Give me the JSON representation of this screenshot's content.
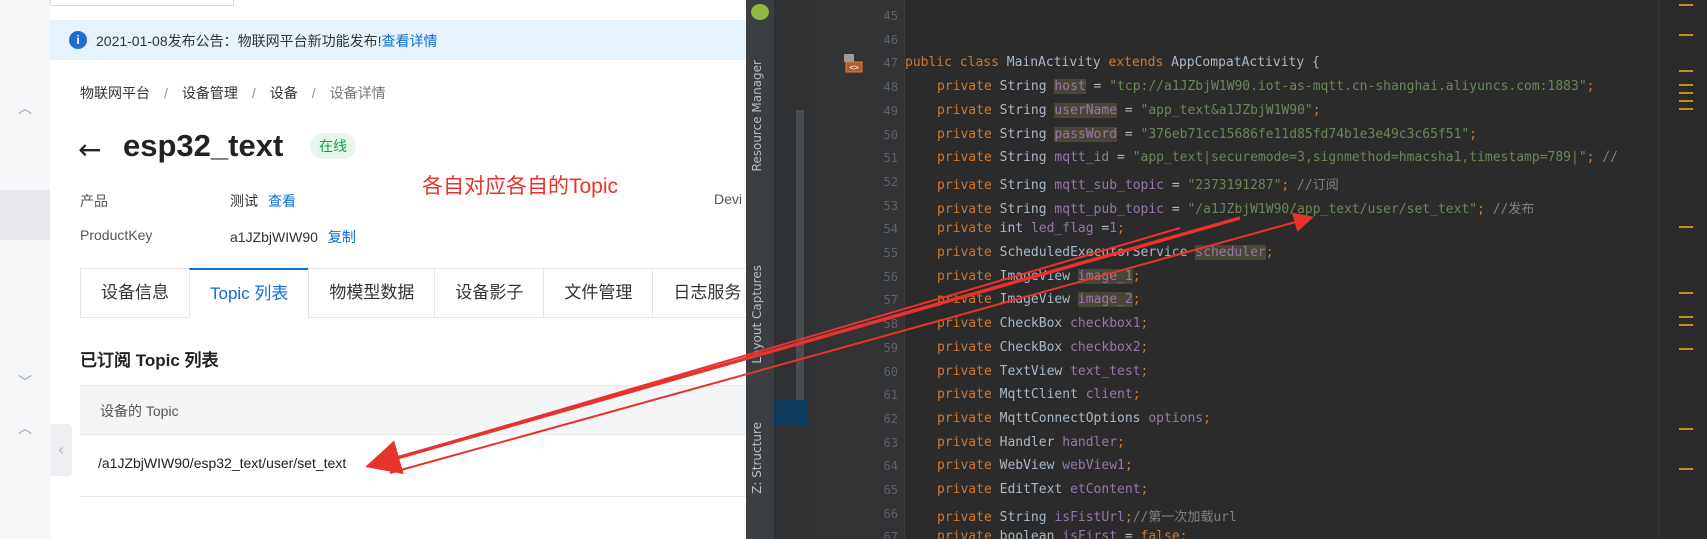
{
  "notice": {
    "text": "2021-01-08发布公告：物联网平台新功能发布!",
    "link": "查看详情"
  },
  "breadcrumb": [
    "物联网平台",
    "设备管理",
    "设备",
    "设备详情"
  ],
  "device": {
    "name": "esp32_text",
    "status": "在线",
    "product_label": "产品",
    "product_value": "测试",
    "product_link": "查看",
    "productkey_label": "ProductKey",
    "productkey_value": "a1JZbjWIW90",
    "productkey_link": "复制",
    "device_label_cut": "Devi"
  },
  "annotation": "各自对应各自的Topic",
  "tabs": [
    "设备信息",
    "Topic 列表",
    "物模型数据",
    "设备影子",
    "文件管理",
    "日志服务"
  ],
  "active_tab": 1,
  "subscribed": {
    "title": "已订阅 Topic 列表",
    "column": "设备的 Topic",
    "rows": [
      "/a1JZbjWIW90/esp32_text/user/set_text"
    ]
  },
  "ide": {
    "tool_tabs": [
      "Resource Manager",
      "Layout Captures",
      "Z: Structure"
    ],
    "line_numbers": [
      45,
      46,
      47,
      48,
      49,
      50,
      51,
      52,
      53,
      54,
      55,
      56,
      57,
      58,
      59,
      60,
      61,
      62,
      63,
      64,
      65,
      66,
      67
    ],
    "code": {
      "l47": {
        "a": "public class ",
        "b": "MainActivity ",
        "c": "extends ",
        "d": "AppCompatActivity {"
      },
      "l48": {
        "kw": "private ",
        "type": "String ",
        "name": "host",
        "rest": " = ",
        "str": "\"tcp://a1JZbjW1W90.iot-as-mqtt.cn-shanghai.aliyuncs.com:1883\"",
        "end": ";"
      },
      "l49": {
        "kw": "private ",
        "type": "String ",
        "name": "userName",
        "rest": " = ",
        "str": "\"app_text&a1JZbjW1W90\"",
        "end": ";"
      },
      "l50": {
        "kw": "private ",
        "type": "String ",
        "name": "passWord",
        "rest": " = ",
        "str": "\"376eb71cc15686fe11d85fd74b1e3e49c3c65f51\"",
        "end": ";"
      },
      "l51": {
        "kw": "private ",
        "type": "String ",
        "name": "mqtt_id",
        "rest": " = ",
        "str": "\"app_text|securemode=3,signmethod=hmacsha1,timestamp=789|\"",
        "end": "; //"
      },
      "l52": {
        "kw": "private ",
        "type": "String ",
        "name": "mqtt_sub_topic",
        "rest": " = ",
        "str": "\"2373191287\"",
        "end": "; //订阅"
      },
      "l53": {
        "kw": "private ",
        "type": "String ",
        "name": "mqtt_pub_topic",
        "rest": " = ",
        "str": "\"/a1JZbjW1W90/app_text/user/set_text\"",
        "end": "; //发布"
      },
      "l54": {
        "kw": "private ",
        "type": "int ",
        "name": "led_flag",
        "rest": " =",
        "num": "1",
        "end": ";"
      },
      "l55": {
        "kw": "private ",
        "type": "ScheduledExecutorService ",
        "name": "scheduler",
        "end": ";"
      },
      "l56": {
        "kw": "private ",
        "type": "ImageView ",
        "name": "image_1",
        "end": ";"
      },
      "l57": {
        "kw": "private ",
        "type": "ImageView ",
        "name": "image_2",
        "end": ";"
      },
      "l58": {
        "kw": "private ",
        "type": "CheckBox ",
        "name": "checkbox1",
        "end": ";"
      },
      "l59": {
        "kw": "private ",
        "type": "CheckBox ",
        "name": "checkbox2",
        "end": ";"
      },
      "l60": {
        "kw": "private ",
        "type": "TextView ",
        "name": "text_test",
        "end": ";"
      },
      "l61": {
        "kw": "private ",
        "type": "MqttClient ",
        "name": "client",
        "end": ";"
      },
      "l62": {
        "kw": "private ",
        "type": "MqttConnectOptions ",
        "name": "options",
        "end": ";"
      },
      "l63": {
        "kw": "private ",
        "type": "Handler ",
        "name": "handler",
        "end": ";"
      },
      "l64": {
        "kw": "private ",
        "type": "WebView ",
        "name": "webView1",
        "end": ";"
      },
      "l65": {
        "kw": "private ",
        "type": "EditText ",
        "name": "etContent",
        "end": ";"
      },
      "l66": {
        "kw": "private ",
        "type": "String ",
        "name": "isFistUrl",
        "end": ";//第一次加载url"
      },
      "l67": {
        "kw": "private ",
        "type": "boolean ",
        "name": "isFirst",
        "rest": " = ",
        "kw2": "false",
        "end": ";"
      }
    }
  },
  "colors": {
    "accent": "#0f6cd8",
    "annotation_red": "#e8332c",
    "online_green": "#1c9c4a"
  }
}
